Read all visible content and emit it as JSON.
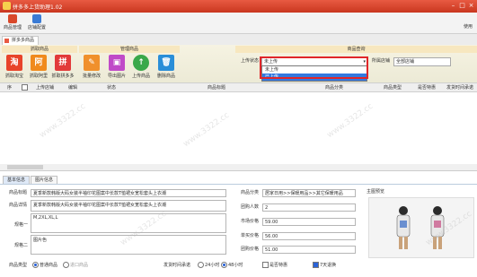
{
  "app": {
    "title": "拼多多上货助理1.02"
  },
  "menubar": {
    "items": [
      {
        "label": "商品管理"
      },
      {
        "label": "店铺配置"
      }
    ],
    "right_label": "使用"
  },
  "tab": {
    "label": "拼多多商品"
  },
  "toolbar": {
    "groups": {
      "grab": "抓取商品",
      "manage": "管理商品",
      "query": "商品查询"
    },
    "buttons": [
      {
        "label": "抓取淘宝",
        "color": "#e8442a",
        "glyph": "淘"
      },
      {
        "label": "抓取阿里",
        "color": "#f08a1c",
        "glyph": "阿"
      },
      {
        "label": "抓取拼多多",
        "color": "#e23a3a",
        "glyph": "拼"
      },
      {
        "label": "批量修改",
        "color": "#f0902c",
        "glyph": "✎"
      },
      {
        "label": "导出图片",
        "color": "#c04ac8",
        "glyph": "▣"
      },
      {
        "label": "上传商品",
        "color": "#3aa84a",
        "glyph": "↑"
      },
      {
        "label": "删除商品",
        "color": "#2a8ed8",
        "glyph": "🗑"
      }
    ],
    "upload_status_label": "上传状态",
    "upload_status_value": "未上传",
    "upload_status_options": [
      "未上传",
      "已上传"
    ],
    "shop_label": "所属店铺",
    "shop_value": "全部店铺"
  },
  "grid": {
    "headers": [
      "序",
      "",
      "上传店铺",
      "编辑",
      "状态",
      "商品标题",
      "商品分类",
      "商品类型",
      "是否特惠",
      "发货时间承诺"
    ]
  },
  "bottom_tabs": [
    "基本信息",
    "图片信息"
  ],
  "form": {
    "title_label": "商品标题",
    "title_value": "夏季新款韩版大码女装半袖印花图案中长款T恤裙女宽松套头上衣潮",
    "detail_label": "商品详情",
    "detail_value": "夏季新款韩版大码女装半袖印花图案中长款T恤裙女宽松套头上衣潮",
    "spec1_label": "规格一",
    "spec1_value": "M,2XL,XL,L",
    "spec2_label": "规格二",
    "spec2_value": "图片色",
    "category_label": "商品分类",
    "category_value": "居家日用>>保暖用品>>其它保暖用品",
    "group_label": "团购人数",
    "group_value": "2",
    "market_label": "市场价格",
    "market_value": "59.00",
    "single_label": "单买价格",
    "single_value": "56.00",
    "groupprice_label": "团购价格",
    "groupprice_value": "51.00",
    "main_image_label": "主图预览",
    "type_label": "商品类型",
    "type_normal": "普通商品",
    "type_import": "进口商品",
    "ship_label": "发货时间承诺",
    "ship_24": "24小时",
    "ship_48": "48小时",
    "special_label": "是否特惠",
    "return_label": "7天退换"
  },
  "watermark": "www.3322.cc"
}
